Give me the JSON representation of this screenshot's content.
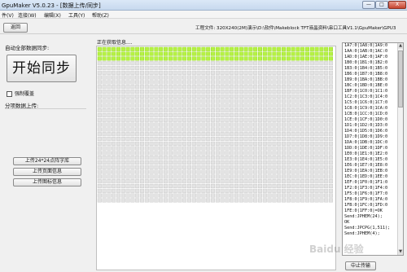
{
  "window": {
    "title": "GpuMaker V5.0.23 - [数据上传/同步]",
    "min_label": "—",
    "max_label": "□",
    "close_label": "X"
  },
  "menu": [
    "件(V)",
    "连接(W)",
    "编辑(X)",
    "工具(Y)",
    "帮助(Z)"
  ],
  "toolbar": {
    "back_label": "返回",
    "project_file": "工程文件: 320X240(2M)演示\\D:\\软件\\Makeblock TFT液晶资料\\串口工具V1.1\\GpuMaker\\GPU3"
  },
  "left": {
    "auto_label": "自动全部数据同步:",
    "start_sync_label": "开始同步",
    "force_update_label": "强制覆盖",
    "split_label": "分项数据上传:",
    "upload_buttons": [
      "上传24*24点阵字库",
      "上传页面信息",
      "上传图标信息"
    ]
  },
  "status": {
    "reading_label": "正在获取信息...."
  },
  "progress": {
    "total_cells": 1650,
    "filled_cells": 150
  },
  "log": {
    "lines": [
      "1A7:0|1A8:0|1A9:0",
      "1AA:0|1AB:0|1AC:0",
      "1AD:0|1AE:0|1AF:0",
      "1B0:0|1B1:0|1B2:0",
      "1B3:0|1B4:0|1B5:0",
      "1B6:0|1B7:0|1B8:0",
      "1B9:0|1BA:0|1BB:0",
      "1BC:0|1BD:0|1BE:0",
      "1BF:0|1C0:0|1C1:0",
      "1C2:0|1C3:0|1C4:0",
      "1C5:0|1C6:0|1C7:0",
      "1C8:0|1C9:0|1CA:0",
      "1CB:0|1CC:0|1CD:0",
      "1CE:0|1CF:0|1D0:0",
      "1D1:0|1D2:0|1D3:0",
      "1D4:0|1D5:0|1D6:0",
      "1D7:0|1D8:0|1D9:0",
      "1DA:0|1DB:0|1DC:0",
      "1DD:0|1DE:0|1DF:0",
      "1E0:0|1E1:0|1E2:0",
      "1E3:0|1E4:0|1E5:0",
      "1E6:0|1E7:0|1E8:0",
      "1E9:0|1EA:0|1EB:0",
      "1EC:0|1ED:0|1EE:0",
      "1EF:0|1F0:0|1F1:0",
      "1F2:0|1F3:0|1F4:0",
      "1F5:0|1F6:0|1F7:0",
      "1F8:0|1F9:0|1FA:0",
      "1FB:0|1FC:0|1FD:0",
      "1FE:0|1FF:0|=OK",
      "Send:JPHEM(24);",
      "OK",
      "Send:JPCPG(1,511);",
      "Send:JPHEM(4);"
    ]
  },
  "stop_label": "中止传输",
  "watermark": "Baidu 经验",
  "colors": {
    "filled": "#b5f243",
    "empty": "#e3e3e3"
  }
}
